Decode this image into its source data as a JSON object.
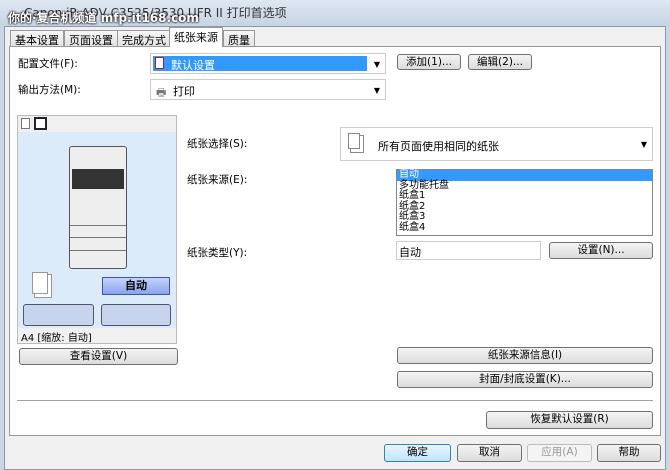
{
  "window": {
    "title": "Canon iR-ADV C3525/3530 UFR II 打印首选项",
    "watermark": "你的·复合机频道 mfp.it168.com"
  },
  "tabs": [
    {
      "label": "基本设置"
    },
    {
      "label": "页面设置"
    },
    {
      "label": "完成方式"
    },
    {
      "label": "纸张来源",
      "active": true
    },
    {
      "label": "质量"
    }
  ],
  "profile": {
    "label": "配置文件(F):",
    "value": "默认设置",
    "add": "添加(1)...",
    "edit": "编辑(2)..."
  },
  "output": {
    "label": "输出方法(M):",
    "value": "打印"
  },
  "preview": {
    "source_badge": "自动",
    "status": "A4 [缩放: 自动]",
    "view_button": "查看设置(V)"
  },
  "paper_selection": {
    "label": "纸张选择(S):",
    "value": "所有页面使用相同的纸张"
  },
  "paper_source": {
    "label": "纸张来源(E):",
    "options": [
      "自动",
      "多功能托盘",
      "纸盒1",
      "纸盒2",
      "纸盒3",
      "纸盒4"
    ],
    "selected": 0
  },
  "paper_type": {
    "label": "纸张类型(Y):",
    "value": "自动",
    "settings": "设置(N)..."
  },
  "buttons": {
    "source_info": "纸张来源信息(I)",
    "cover": "封面/封底设置(K)...",
    "restore": "恢复默认设置(R)"
  },
  "footer": {
    "ok": "确定",
    "cancel": "取消",
    "apply": "应用(A)",
    "help": "帮助"
  },
  "colors": {
    "selection": "#3399ff",
    "preview_bg": "#dcebfa"
  }
}
